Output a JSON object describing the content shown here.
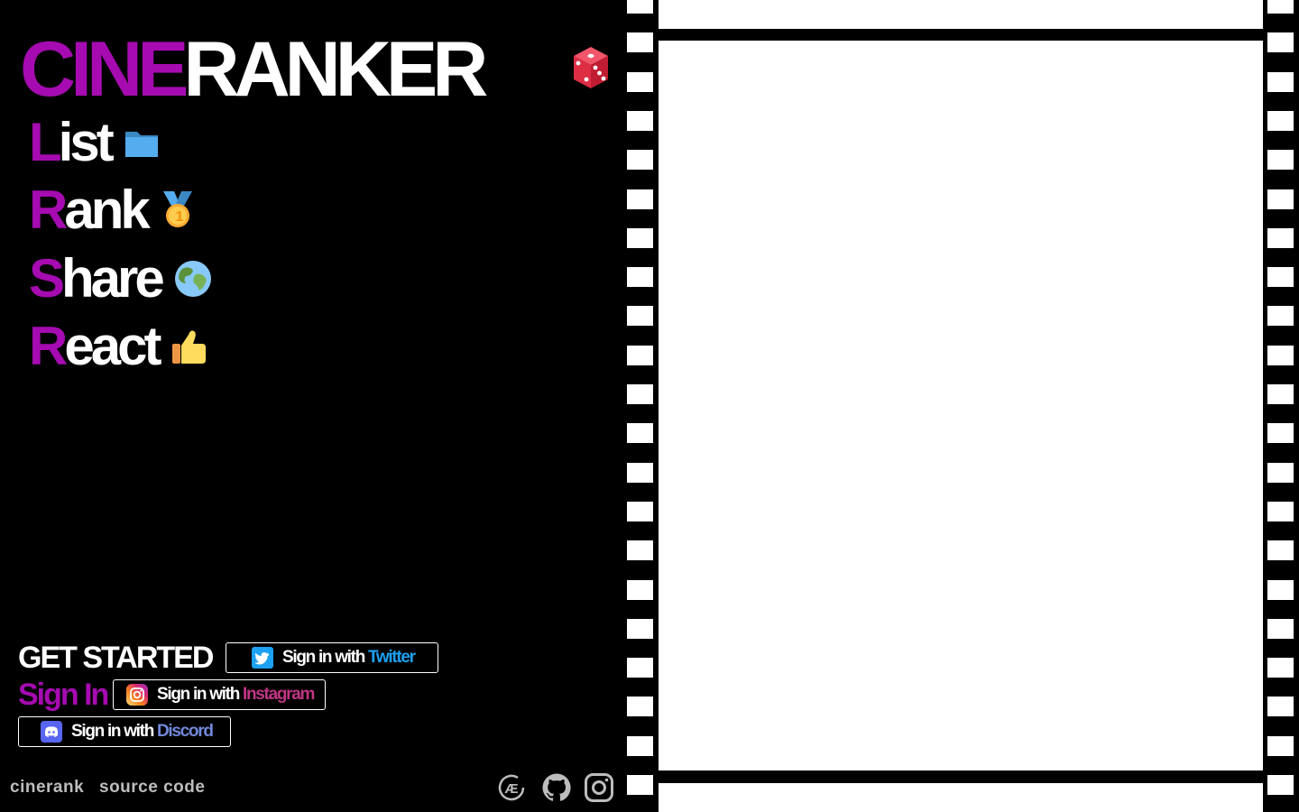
{
  "brand": {
    "part1": "CINE",
    "part2": "RANKER",
    "dice_icon": "dice-icon"
  },
  "features": [
    {
      "first": "L",
      "rest": "ist",
      "icon": "folder-icon"
    },
    {
      "first": "R",
      "rest": "ank",
      "icon": "medal-icon"
    },
    {
      "first": "S",
      "rest": "hare",
      "icon": "globe-icon"
    },
    {
      "first": "R",
      "rest": "eact",
      "icon": "thumbs-up-icon"
    }
  ],
  "auth": {
    "get_started": "GET STARTED",
    "sign_in": "Sign In",
    "twitter": {
      "prefix": "Sign in with",
      "provider": "Twitter",
      "color": "#1da1f2"
    },
    "instagram": {
      "prefix": "Sign in with",
      "provider": "Instagram",
      "color": "#c13584"
    },
    "discord": {
      "prefix": "Sign in with",
      "provider": "Discord",
      "color": "#7289da"
    }
  },
  "footer": {
    "links": [
      "cinerank",
      "source code"
    ],
    "icons": [
      "ae-logo-icon",
      "github-icon",
      "instagram-icon"
    ]
  },
  "colors": {
    "accent": "#a50bb0",
    "background": "#000000",
    "text": "#ffffff"
  }
}
